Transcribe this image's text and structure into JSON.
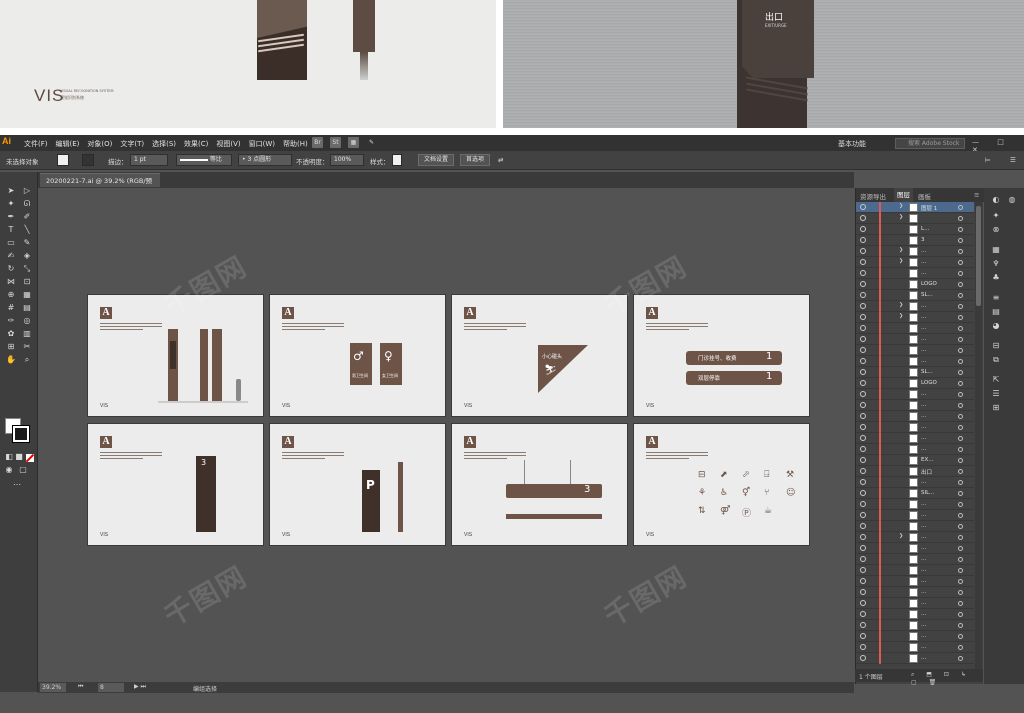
{
  "preview": {
    "vis_logo": "VIS",
    "vis_sub1": "VISUAL RECOGNITION SYSTEM",
    "vis_sub2": "视觉识别系统",
    "exit_text": "出口",
    "exit_sub": "EXIT/URGE"
  },
  "menubar": {
    "app_logo": "Ai",
    "items": [
      "文件(F)",
      "编辑(E)",
      "对象(O)",
      "文字(T)",
      "选择(S)",
      "效果(C)",
      "视图(V)",
      "窗口(W)",
      "帮助(H)"
    ],
    "icons": [
      "Br",
      "St"
    ],
    "workspace": "基本功能",
    "stock_placeholder": "搜索 Adobe Stock",
    "window_buttons": "— □ ✕"
  },
  "controlbar": {
    "selection": "未选择对象",
    "stroke_label": "描边：",
    "stroke_value": "1 pt",
    "profile": "等比",
    "brush": "3 点圆形",
    "opacity_label": "不透明度：",
    "opacity_value": "100%",
    "style_label": "样式：",
    "doc_setup": "文档设置",
    "prefs": "首选项"
  },
  "document": {
    "tab_title": "20200221-7.ai @ 39.2% (RGB/预览)",
    "close": "✕"
  },
  "statusbar": {
    "zoom": "39.2%",
    "page": "8",
    "mode": "编组选择"
  },
  "artboards": {
    "a_letter": "A",
    "vis_mark": "VIS",
    "ab2_left": "男卫生间",
    "ab2_right": "女卫生间",
    "ab3_sign": "小心碰头",
    "ab4_row1": "门诊挂号、收费",
    "ab4_row2": "双层停靠",
    "ab4_num": "1",
    "ab5_num": "3",
    "ab6_letter": "P",
    "ab7_num": "3"
  },
  "layers_panel": {
    "tabs": [
      "资源导出",
      "图层",
      "画板"
    ],
    "active_tab": "图层",
    "rows": [
      {
        "name": "图层 1",
        "expand": true
      },
      {
        "name": "",
        "expand": true
      },
      {
        "name": "L...",
        "expand": false
      },
      {
        "name": "3",
        "expand": false
      },
      {
        "name": "...",
        "expand": true
      },
      {
        "name": "...",
        "expand": true
      },
      {
        "name": "...",
        "expand": false
      },
      {
        "name": "LOGO",
        "expand": false
      },
      {
        "name": "SL...",
        "expand": false
      },
      {
        "name": "...",
        "expand": true
      },
      {
        "name": "...",
        "expand": true
      },
      {
        "name": "...",
        "expand": false
      },
      {
        "name": "...",
        "expand": false
      },
      {
        "name": "...",
        "expand": false
      },
      {
        "name": "...",
        "expand": false
      },
      {
        "name": "SL...",
        "expand": false
      },
      {
        "name": "LOGO",
        "expand": false
      },
      {
        "name": "...",
        "expand": false
      },
      {
        "name": "...",
        "expand": false
      },
      {
        "name": "...",
        "expand": false
      },
      {
        "name": "...",
        "expand": false
      },
      {
        "name": "...",
        "expand": false
      },
      {
        "name": "...",
        "expand": false
      },
      {
        "name": "EX...",
        "expand": false
      },
      {
        "name": "出口",
        "expand": false
      },
      {
        "name": "...",
        "expand": false
      },
      {
        "name": "SIL...",
        "expand": false
      },
      {
        "name": "...",
        "expand": false
      },
      {
        "name": "...",
        "expand": false
      },
      {
        "name": "...",
        "expand": false
      },
      {
        "name": "...",
        "expand": true
      },
      {
        "name": "...",
        "expand": false
      },
      {
        "name": "...",
        "expand": false
      },
      {
        "name": "...",
        "expand": false
      },
      {
        "name": "...",
        "expand": false
      },
      {
        "name": "...",
        "expand": false
      },
      {
        "name": "...",
        "expand": false
      },
      {
        "name": "...",
        "expand": false
      },
      {
        "name": "...",
        "expand": false
      },
      {
        "name": "...",
        "expand": false
      },
      {
        "name": "...",
        "expand": false
      },
      {
        "name": "...",
        "expand": false
      }
    ],
    "footer": "1 个图层"
  },
  "colors": {
    "brand_brown": "#6d5447",
    "dark_brown": "#3f302a",
    "layer_color": "#e15a4f",
    "ai_orange": "#ff9a00"
  }
}
